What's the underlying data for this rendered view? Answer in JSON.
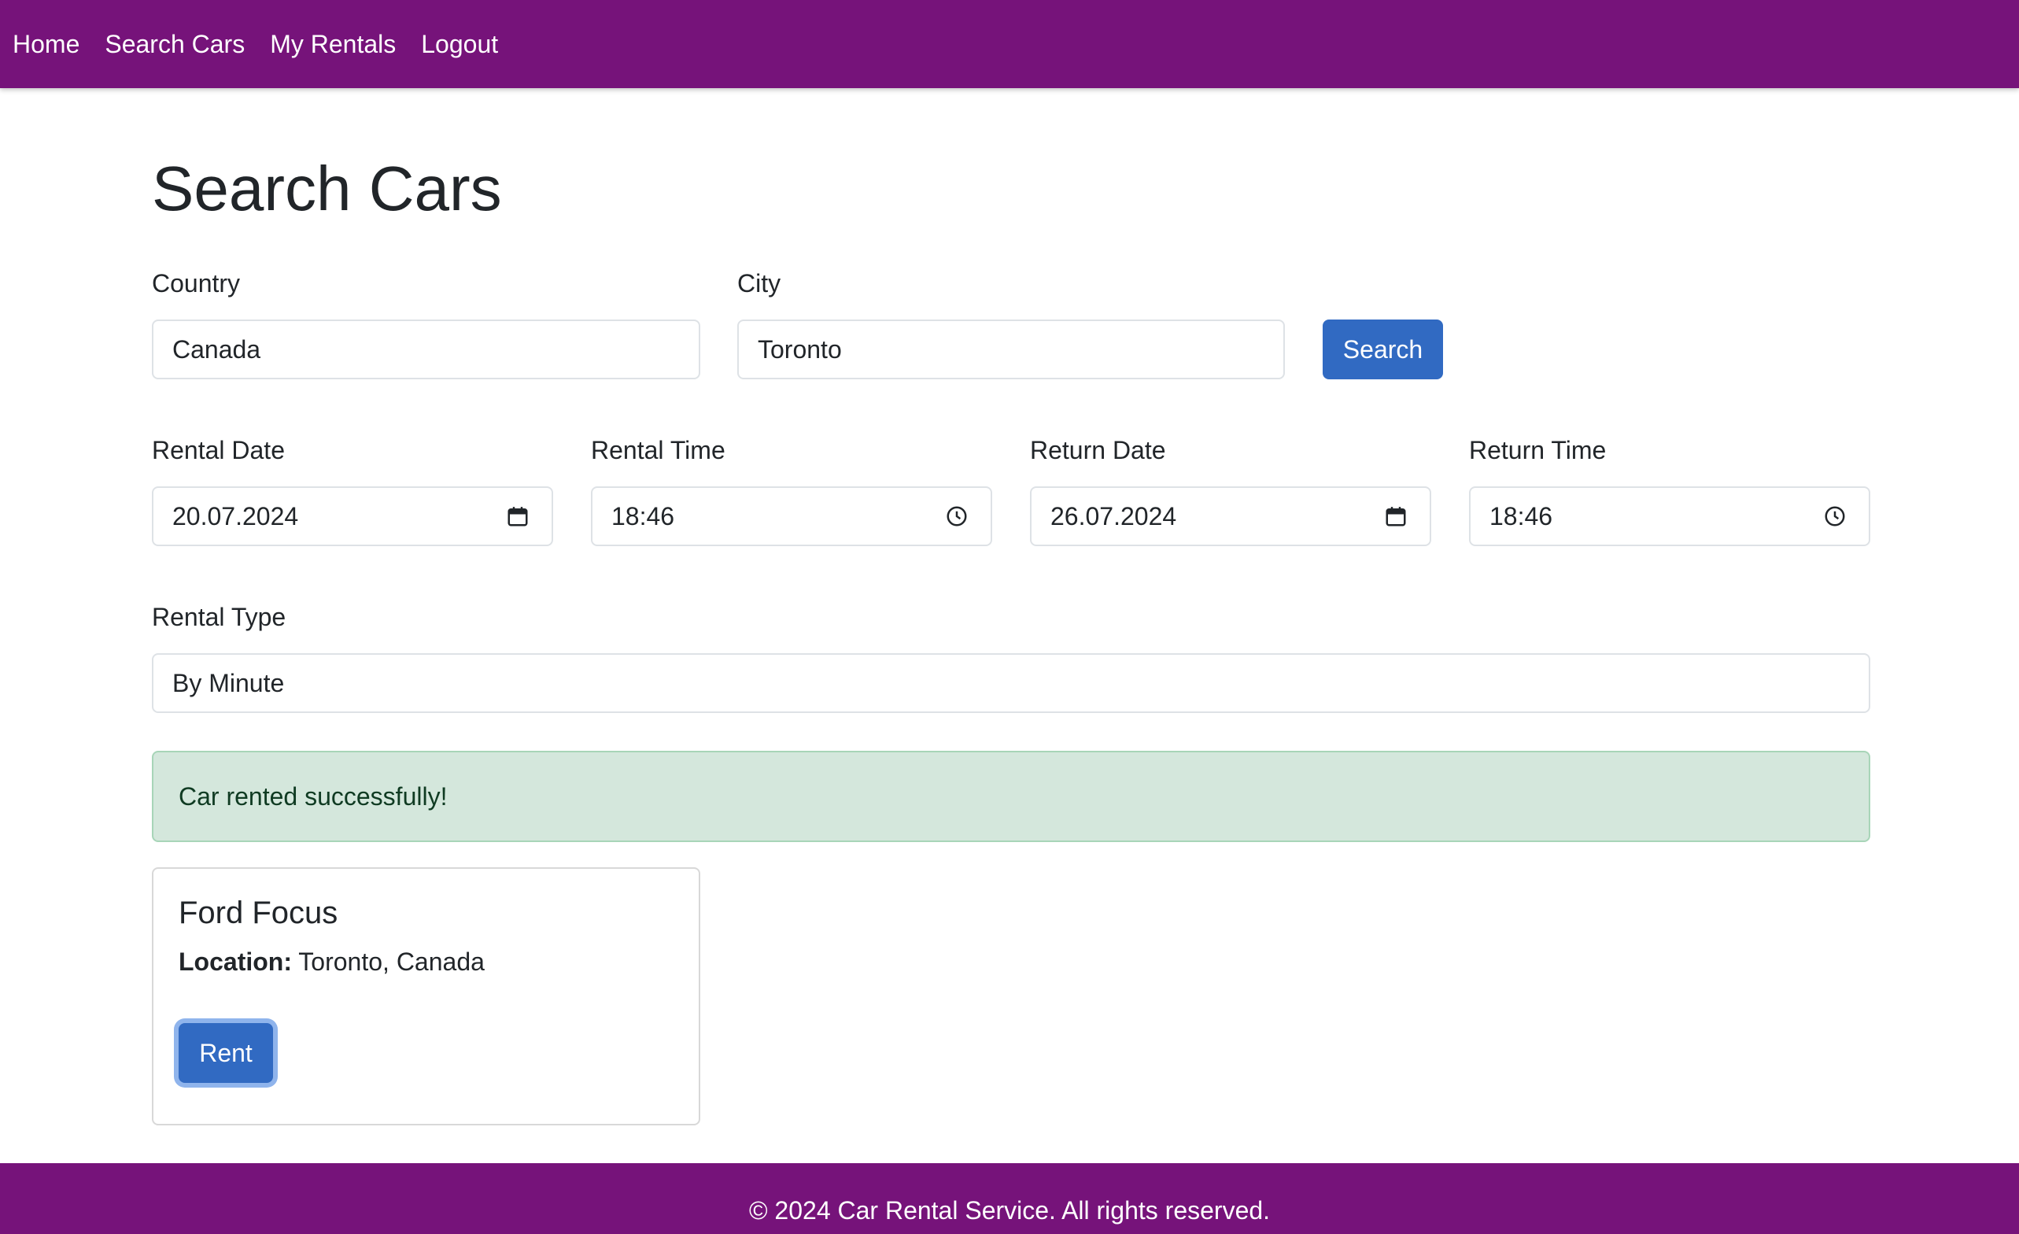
{
  "nav": {
    "items": [
      {
        "label": "Home"
      },
      {
        "label": "Search Cars"
      },
      {
        "label": "My Rentals"
      },
      {
        "label": "Logout"
      }
    ]
  },
  "page": {
    "title": "Search Cars"
  },
  "form": {
    "country": {
      "label": "Country",
      "value": "Canada"
    },
    "city": {
      "label": "City",
      "value": "Toronto"
    },
    "search_button": "Search",
    "rental_date": {
      "label": "Rental Date",
      "value": "20.07.2024",
      "icon": "calendar-icon"
    },
    "rental_time": {
      "label": "Rental Time",
      "value": "18:46",
      "icon": "clock-icon"
    },
    "return_date": {
      "label": "Return Date",
      "value": "26.07.2024",
      "icon": "calendar-icon"
    },
    "return_time": {
      "label": "Return Time",
      "value": "18:46",
      "icon": "clock-icon"
    },
    "rental_type": {
      "label": "Rental Type",
      "value": "By Minute"
    }
  },
  "alert": {
    "message": "Car rented successfully!",
    "color": "#d4e7dc"
  },
  "results": [
    {
      "name": "Ford Focus",
      "location_label": "Location:",
      "location_value": "Toronto, Canada",
      "rent_button": "Rent"
    }
  ],
  "footer": {
    "text": "© 2024 Car Rental Service. All rights reserved."
  },
  "colors": {
    "brand": "#76137a",
    "primary": "#316ac2"
  }
}
